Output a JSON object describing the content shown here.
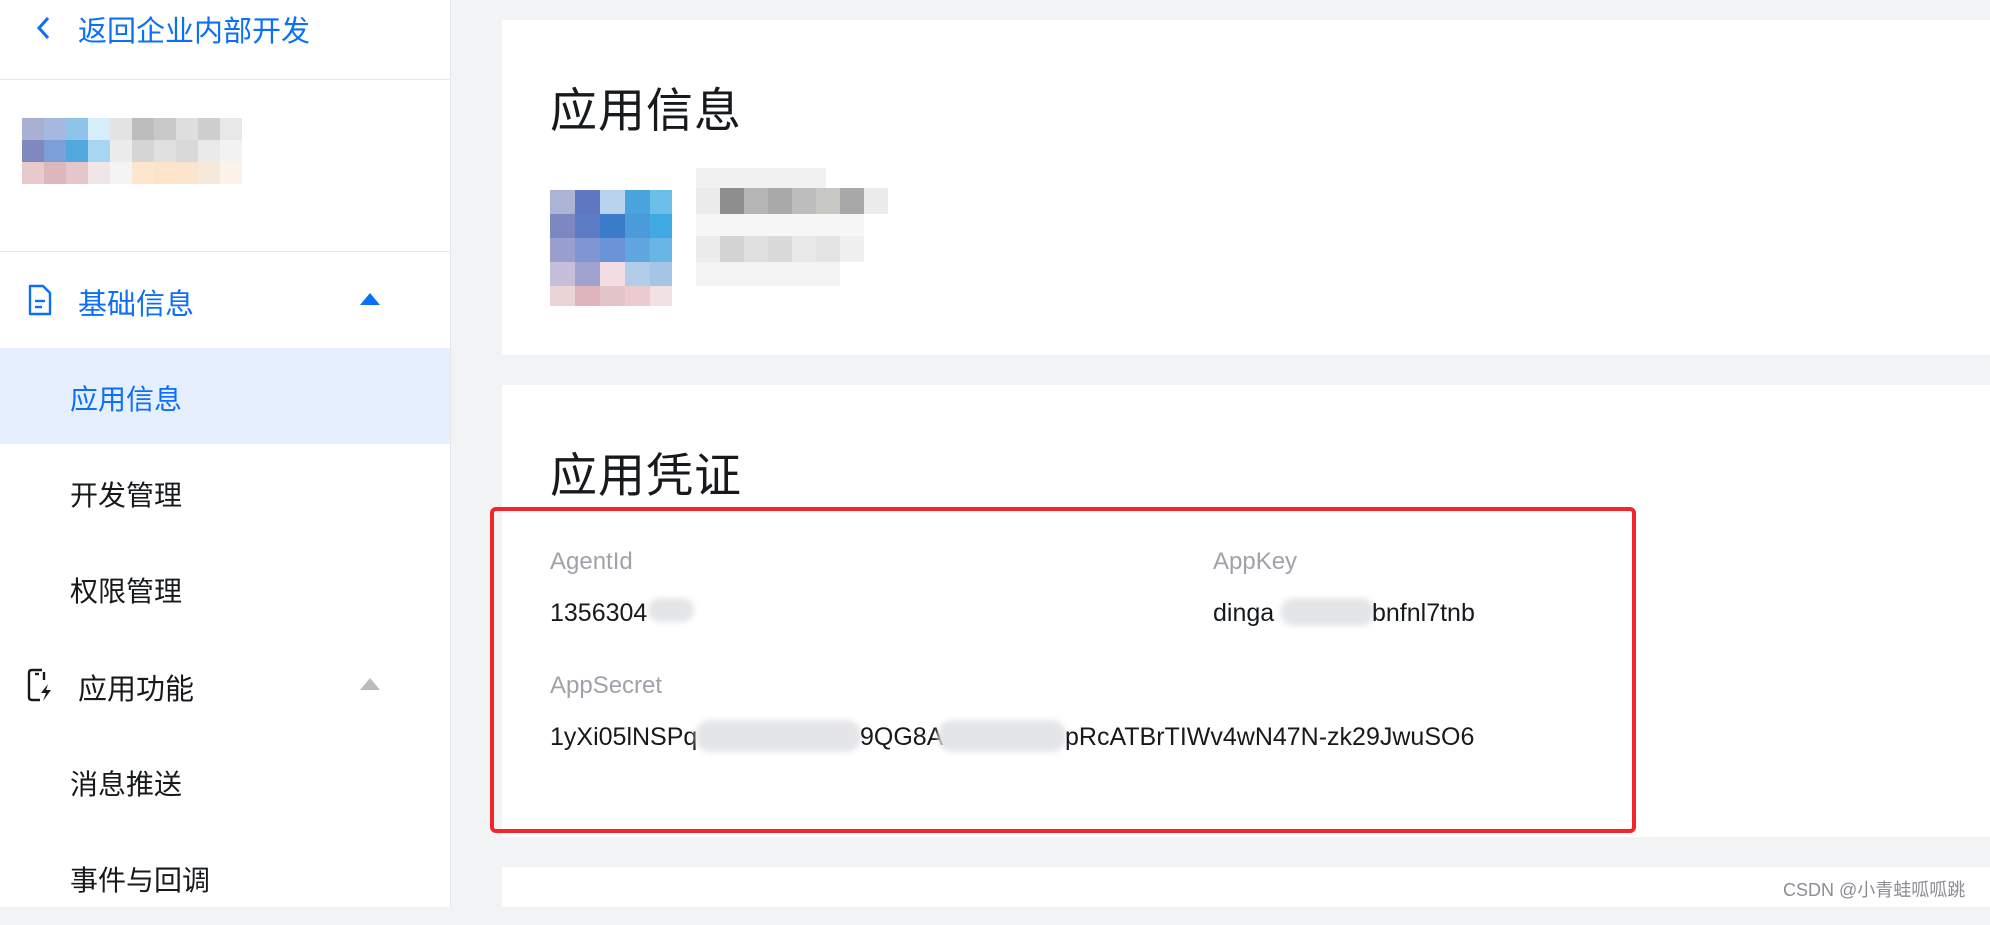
{
  "sidebar": {
    "back_label": "返回企业内部开发",
    "groups": [
      {
        "label": "基础信息",
        "icon": "document-icon",
        "expanded": true,
        "items": [
          {
            "label": "应用信息",
            "active": true
          },
          {
            "label": "开发管理",
            "active": false
          },
          {
            "label": "权限管理",
            "active": false
          }
        ]
      },
      {
        "label": "应用功能",
        "icon": "phone-bolt-icon",
        "expanded": true,
        "items": [
          {
            "label": "消息推送",
            "active": false
          },
          {
            "label": "事件与回调",
            "active": false
          }
        ]
      }
    ]
  },
  "main": {
    "app_info": {
      "title": "应用信息"
    },
    "credentials": {
      "title": "应用凭证",
      "agent_id_label": "AgentId",
      "agent_id_value": "1356304",
      "app_key_label": "AppKey",
      "app_key_prefix": "dinga",
      "app_key_suffix": "bnfnl7tnb",
      "app_secret_label": "AppSecret",
      "app_secret_part1": "1yXi05lNSPq",
      "app_secret_part2": "9QG8A",
      "app_secret_part3": "pRcATBrTIWv4wN47N-zk29JwuSO6"
    }
  },
  "watermark": "CSDN @小青蛙呱呱跳",
  "colors": {
    "accent": "#0b6ff7",
    "active_bg": "#e6effd",
    "highlight": "#f0262b",
    "background": "#f2f3f5"
  }
}
